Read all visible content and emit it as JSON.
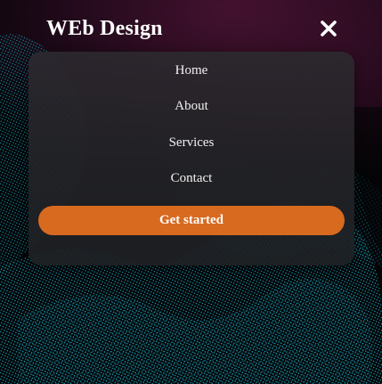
{
  "header": {
    "brand": "WEb Design",
    "close_icon": "close-icon"
  },
  "menu": {
    "items": [
      {
        "label": "Home"
      },
      {
        "label": "About"
      },
      {
        "label": "Services"
      },
      {
        "label": "Contact"
      }
    ],
    "cta_label": "Get started"
  },
  "colors": {
    "accent": "#d86a20",
    "dot_pattern": "#1aa8c0",
    "panel": "#2a2a2f",
    "background_glow": "#4a1232"
  }
}
